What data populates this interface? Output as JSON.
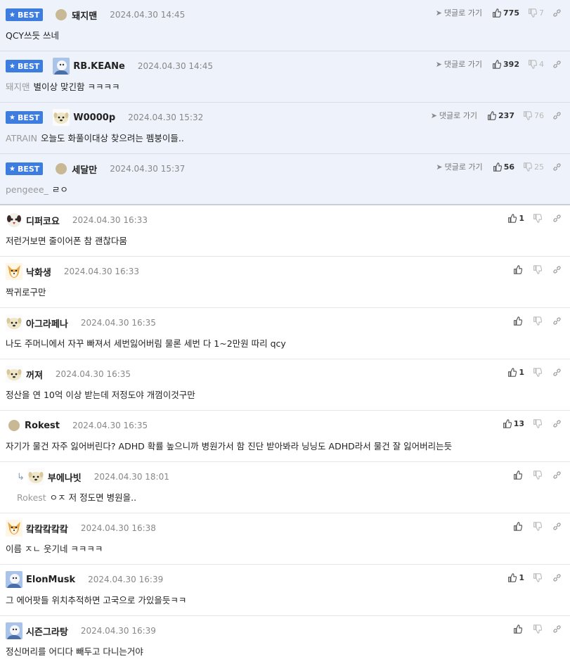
{
  "actions": {
    "reply_label": "댓글로 가기"
  },
  "best_label": "BEST",
  "colors": {
    "best_badge": "#3d7de0",
    "best_bg": "#eef2fb"
  },
  "comments": [
    {
      "best": true,
      "avatar": "dot",
      "nick": "돼지맨",
      "date": "2024.04.30 14:45",
      "mention": "",
      "text": "QCY쓰듯 쓰네",
      "up": "775",
      "down": "7"
    },
    {
      "best": true,
      "avatar": "pic",
      "nick": "RB.KEANe",
      "date": "2024.04.30 14:45",
      "mention": "돼지맨",
      "text": "별이상 맞긴함 ㅋㅋㅋㅋ",
      "up": "392",
      "down": "4"
    },
    {
      "best": true,
      "avatar": "doge",
      "nick": "W0000p",
      "date": "2024.04.30 15:32",
      "mention": "ATRAIN",
      "text": "오늘도 화풀이대상 찾으려는 펨붕이들..",
      "up": "237",
      "down": "76"
    },
    {
      "best": true,
      "avatar": "dot",
      "nick": "세달만",
      "date": "2024.04.30 15:37",
      "mention": "pengeee_",
      "text": "ㄹㅇ",
      "up": "56",
      "down": "25"
    },
    {
      "best": false,
      "avatar": "dog",
      "nick": "디퍼코요",
      "date": "2024.04.30 16:33",
      "mention": "",
      "text": "저런거보면 줄이어폰 참 괜찮다뭄",
      "up": "1",
      "down": ""
    },
    {
      "best": false,
      "avatar": "fox",
      "nick": "낙화생",
      "date": "2024.04.30 16:33",
      "mention": "",
      "text": "짝귀로구만",
      "up": "",
      "down": ""
    },
    {
      "best": false,
      "avatar": "doge",
      "nick": "아그라페나",
      "date": "2024.04.30 16:35",
      "mention": "",
      "text": "나도 주머니에서 자꾸 빠져서 세번잃어버림 물론 세번 다 1~2만원 따리 qcy",
      "up": "",
      "down": ""
    },
    {
      "best": false,
      "avatar": "doge",
      "nick": "꺼져",
      "date": "2024.04.30 16:35",
      "mention": "",
      "text": "정산을 연 10억 이상 받는데 저정도야 개껌이것구만",
      "up": "1",
      "down": ""
    },
    {
      "best": false,
      "avatar": "dot",
      "nick": "Rokest",
      "date": "2024.04.30 16:35",
      "mention": "",
      "text": "자기가 물건 자주 잃어버린다? ADHD 확률 높으니까 병원가서 함 진단 받아봐라 닝닝도 ADHD라서 물건 잘 잃어버리는듯",
      "up": "13",
      "down": ""
    },
    {
      "best": false,
      "reply": true,
      "avatar": "doge",
      "nick": "부에나빗",
      "date": "2024.04.30 18:01",
      "mention": "Rokest",
      "text": "ㅇㅈ 저 정도면 병원을..",
      "up": "",
      "down": ""
    },
    {
      "best": false,
      "avatar": "fox",
      "nick": "캌캌캌캌캌",
      "date": "2024.04.30 16:38",
      "mention": "",
      "text": "이름 ㅈㄴ 웃기네 ㅋㅋㅋㅋ",
      "up": "",
      "down": ""
    },
    {
      "best": false,
      "avatar": "pic",
      "nick": "ElonMusk",
      "date": "2024.04.30 16:39",
      "mention": "",
      "text": "그 에어팟들 위치추적하면 고국으로 가있을듯ㅋㅋ",
      "up": "1",
      "down": ""
    },
    {
      "best": false,
      "avatar": "pic",
      "nick": "시즌그라탕",
      "date": "2024.04.30 16:39",
      "mention": "",
      "text": "정신머리를 어디다 빼두고 다니는거야",
      "up": "",
      "down": ""
    }
  ]
}
